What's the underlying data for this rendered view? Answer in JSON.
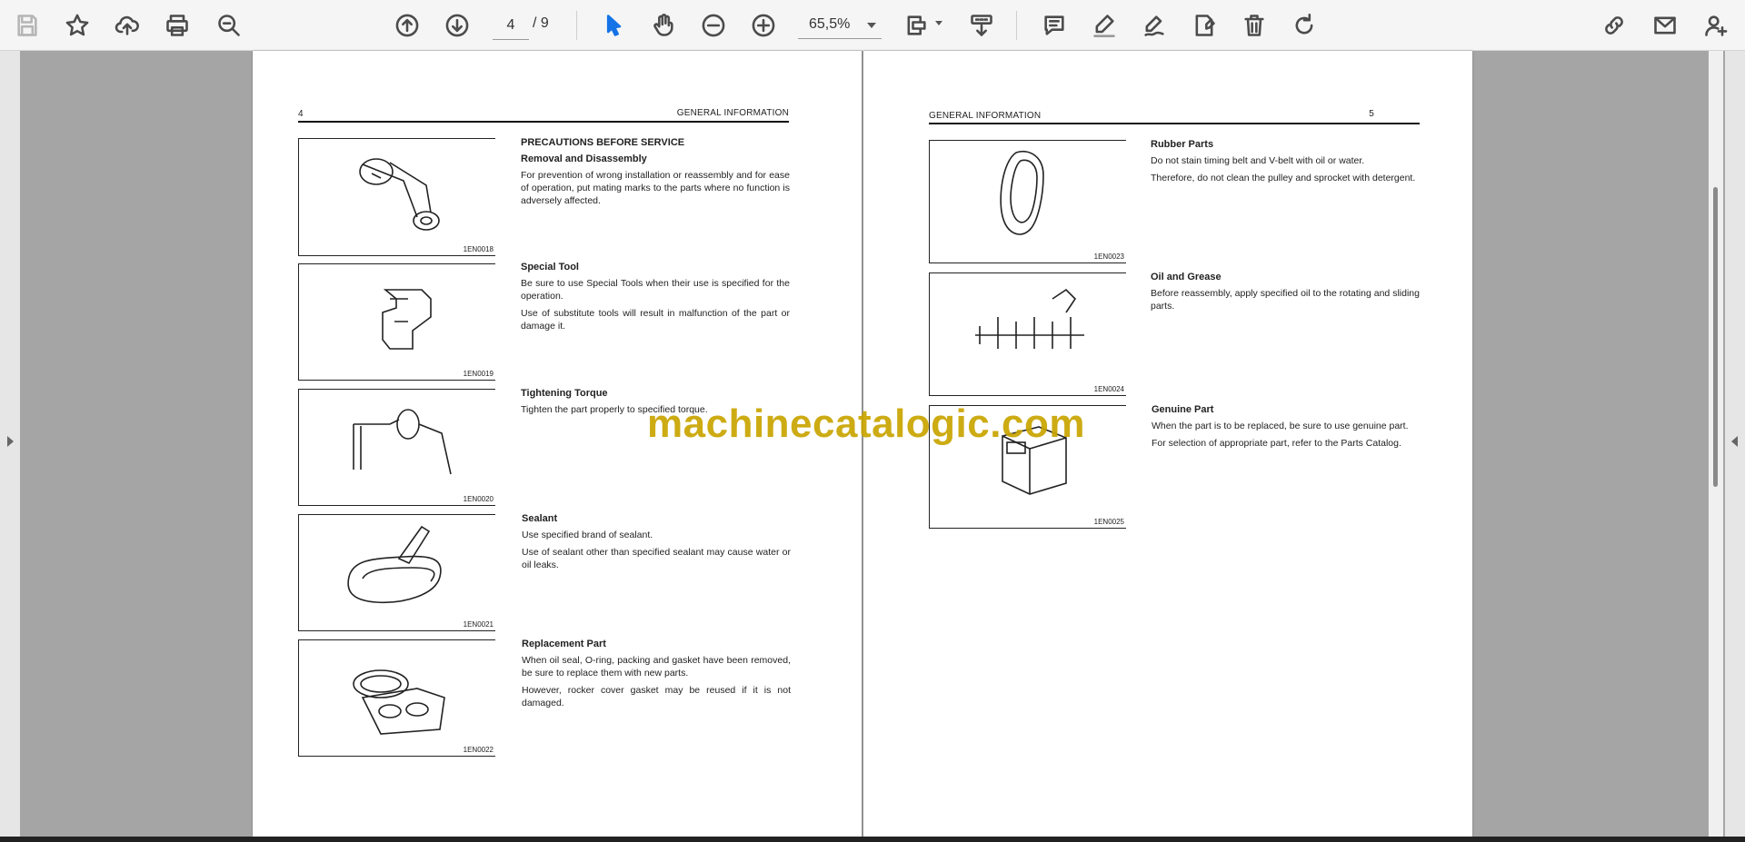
{
  "toolbar": {
    "page_current": "4",
    "page_total": "/ 9",
    "zoom": "65,5%",
    "icons": [
      "save-icon",
      "star-icon",
      "upload-icon",
      "print-icon",
      "zoom-search-icon",
      "page-up-icon",
      "page-down-icon",
      "select-cursor-icon",
      "hand-icon",
      "zoom-out-icon",
      "zoom-in-icon",
      "page-display-icon",
      "scroll-mode-icon",
      "comment-icon",
      "highlight-icon",
      "draw-icon",
      "stamp-icon",
      "delete-icon",
      "rotate-icon",
      "share-link-icon",
      "mail-icon",
      "add-user-icon"
    ]
  },
  "left_page": {
    "page_number": "4",
    "header": "GENERAL INFORMATION",
    "main_title": "PRECAUTIONS BEFORE SERVICE",
    "sections": [
      {
        "heading": "Removal and Disassembly",
        "paragraphs": [
          "For prevention of wrong installation or reassembly and for ease of operation, put mating marks to the parts where no function is adversely affected."
        ],
        "fig_code": "1EN0018"
      },
      {
        "heading": "Special Tool",
        "paragraphs": [
          "Be sure to use Special Tools when their use is specified for the operation.",
          "Use of substitute tools will result in malfunction of the part or damage it."
        ],
        "fig_code": "1EN0019"
      },
      {
        "heading": "Tightening Torque",
        "paragraphs": [
          "Tighten the part properly to specified torque."
        ],
        "fig_code": "1EN0020"
      },
      {
        "heading": "Sealant",
        "paragraphs": [
          "Use specified brand of sealant.",
          "Use of sealant other than specified sealant may cause water or oil leaks."
        ],
        "fig_code": "1EN0021"
      },
      {
        "heading": "Replacement Part",
        "paragraphs": [
          "When oil seal, O-ring, packing and gasket have been removed, be sure to replace them with new parts.",
          "However, rocker cover gasket may be reused if it is not damaged."
        ],
        "fig_code": "1EN0022"
      }
    ]
  },
  "right_page": {
    "page_number": "5",
    "header": "GENERAL INFORMATION",
    "sections": [
      {
        "heading": "Rubber Parts",
        "paragraphs": [
          "Do not stain timing belt and V-belt with oil or water.",
          "Therefore, do not clean the pulley and sprocket with detergent."
        ],
        "fig_code": "1EN0023"
      },
      {
        "heading": "Oil and Grease",
        "paragraphs": [
          "Before reassembly, apply specified oil to the rotating and sliding parts."
        ],
        "fig_code": "1EN0024"
      },
      {
        "heading": "Genuine Part",
        "paragraphs": [
          "When the part is to be replaced, be sure to use genuine part.",
          "For selection of appropriate part, refer to the Parts Catalog."
        ],
        "fig_code": "1EN0025"
      }
    ]
  },
  "watermark": "machinecatalogic.com",
  "colors": {
    "accent": "#1473e6",
    "watermark": "#c9a400",
    "viewer_bg": "#a5a5a5"
  }
}
